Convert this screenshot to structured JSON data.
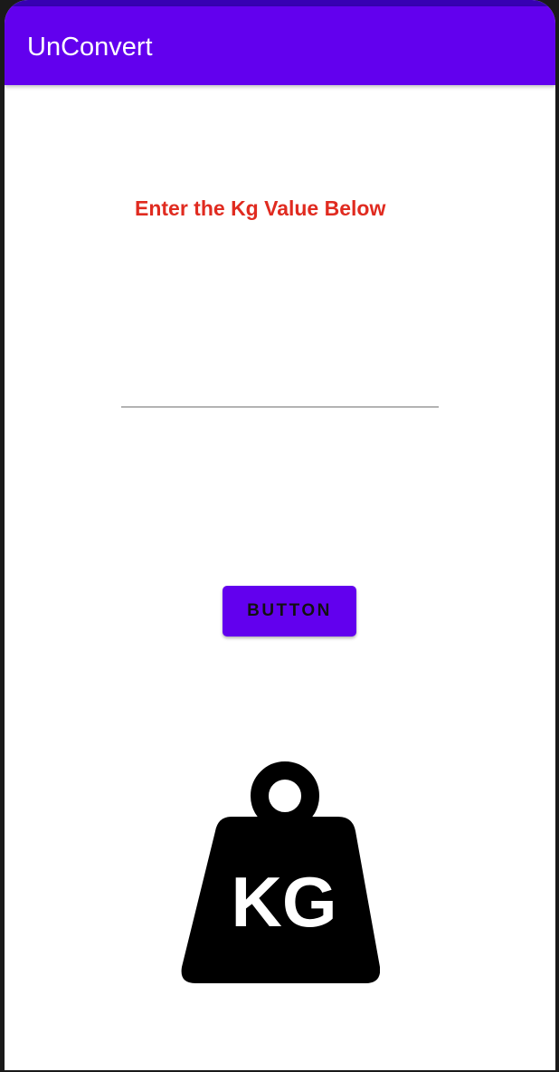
{
  "app_bar": {
    "title": "UnConvert",
    "color": "#6200ee",
    "status_color": "#3700b3"
  },
  "main": {
    "prompt": "Enter the Kg Value Below",
    "prompt_color": "#e02b20",
    "input": {
      "value": "",
      "placeholder": ""
    },
    "button_label": "BUTTON",
    "weight_icon": "kg-weight-icon",
    "weight_text": "KG"
  }
}
